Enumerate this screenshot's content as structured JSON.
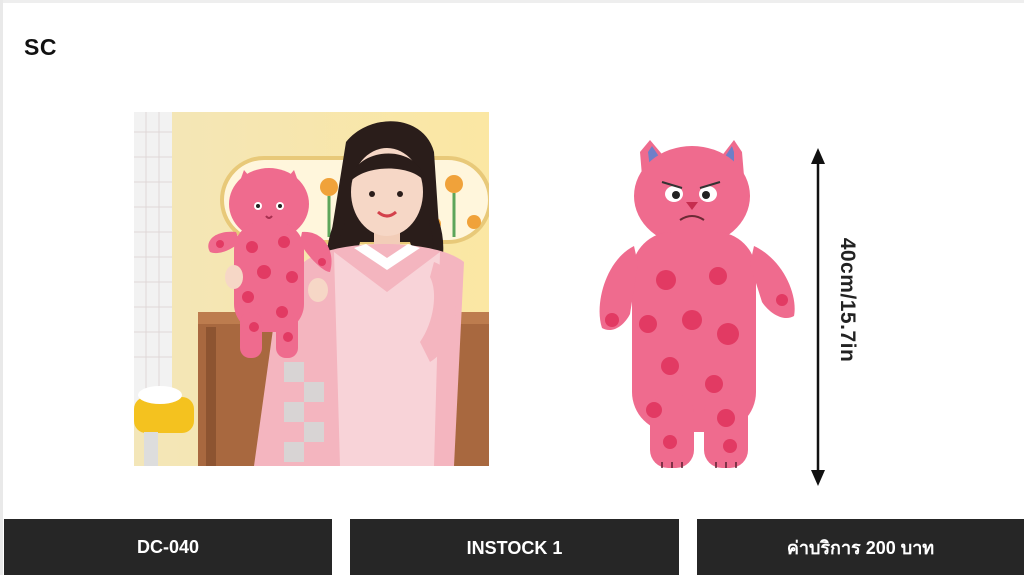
{
  "brand": "SC",
  "photos": {
    "left": {
      "icon": "woman-holding-pink-cat-plush-photo"
    },
    "right": {
      "icon": "pink-cat-plush-product-photo",
      "size_label": "40cm/15.7in"
    }
  },
  "info_bar": {
    "code": "DC-040",
    "stock": "INSTOCK 1",
    "fee": "ค่าบริการ 200  บาท"
  },
  "colors": {
    "bar_background": "#262626",
    "bar_text": "#ffffff",
    "plush_pink": "#ef6b8e",
    "plush_spot": "#e23a63"
  }
}
